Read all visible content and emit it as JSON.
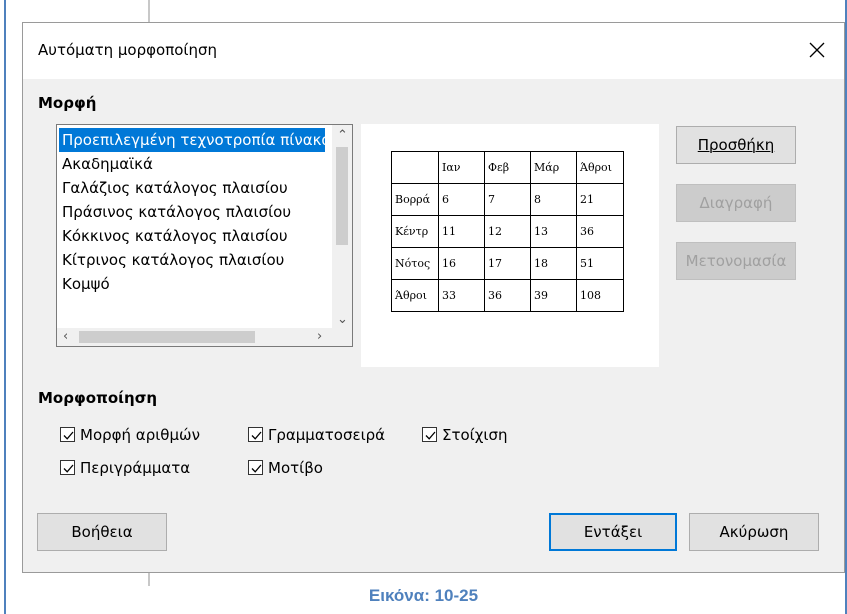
{
  "dialog": {
    "title": "Αυτόματη μορφοποίηση",
    "format_section": "Μορφή",
    "formatting_section": "Μορφοποίηση"
  },
  "format_list": {
    "items": [
      "Προεπιλεγμένη τεχνοτροπία πίνακα",
      "Ακαδημαϊκά",
      "Γαλάζιος κατάλογος πλαισίου",
      "Πράσινος κατάλογος πλαισίου",
      "Κόκκινος κατάλογος πλαισίου",
      "Κίτρινος κατάλογος πλαισίου",
      "Κομψό"
    ],
    "selected_index": 0
  },
  "preview": {
    "header": [
      "",
      "Ιαν",
      "Φεβ",
      "Μάρ",
      "Άθροι"
    ],
    "rows": [
      [
        "Βορρά",
        "6",
        "7",
        "8",
        "21"
      ],
      [
        "Κέντρ",
        "11",
        "12",
        "13",
        "36"
      ],
      [
        "Νότος",
        "16",
        "17",
        "18",
        "51"
      ],
      [
        "Άθροι",
        "33",
        "36",
        "39",
        "108"
      ]
    ]
  },
  "buttons": {
    "add": "Προσθήκη",
    "delete": "Διαγραφή",
    "rename": "Μετονομασία",
    "help": "Βοήθεια",
    "ok": "Εντάξει",
    "cancel": "Ακύρωση"
  },
  "options": {
    "number_format": "Μορφή αριθμών",
    "font": "Γραμματοσειρά",
    "alignment": "Στοίχιση",
    "borders": "Περιγράμματα",
    "pattern": "Μοτίβο"
  },
  "caption": "Εικόνα: 10-25",
  "colors": {
    "selection": "#0078d7",
    "caption": "#4f81bd"
  }
}
